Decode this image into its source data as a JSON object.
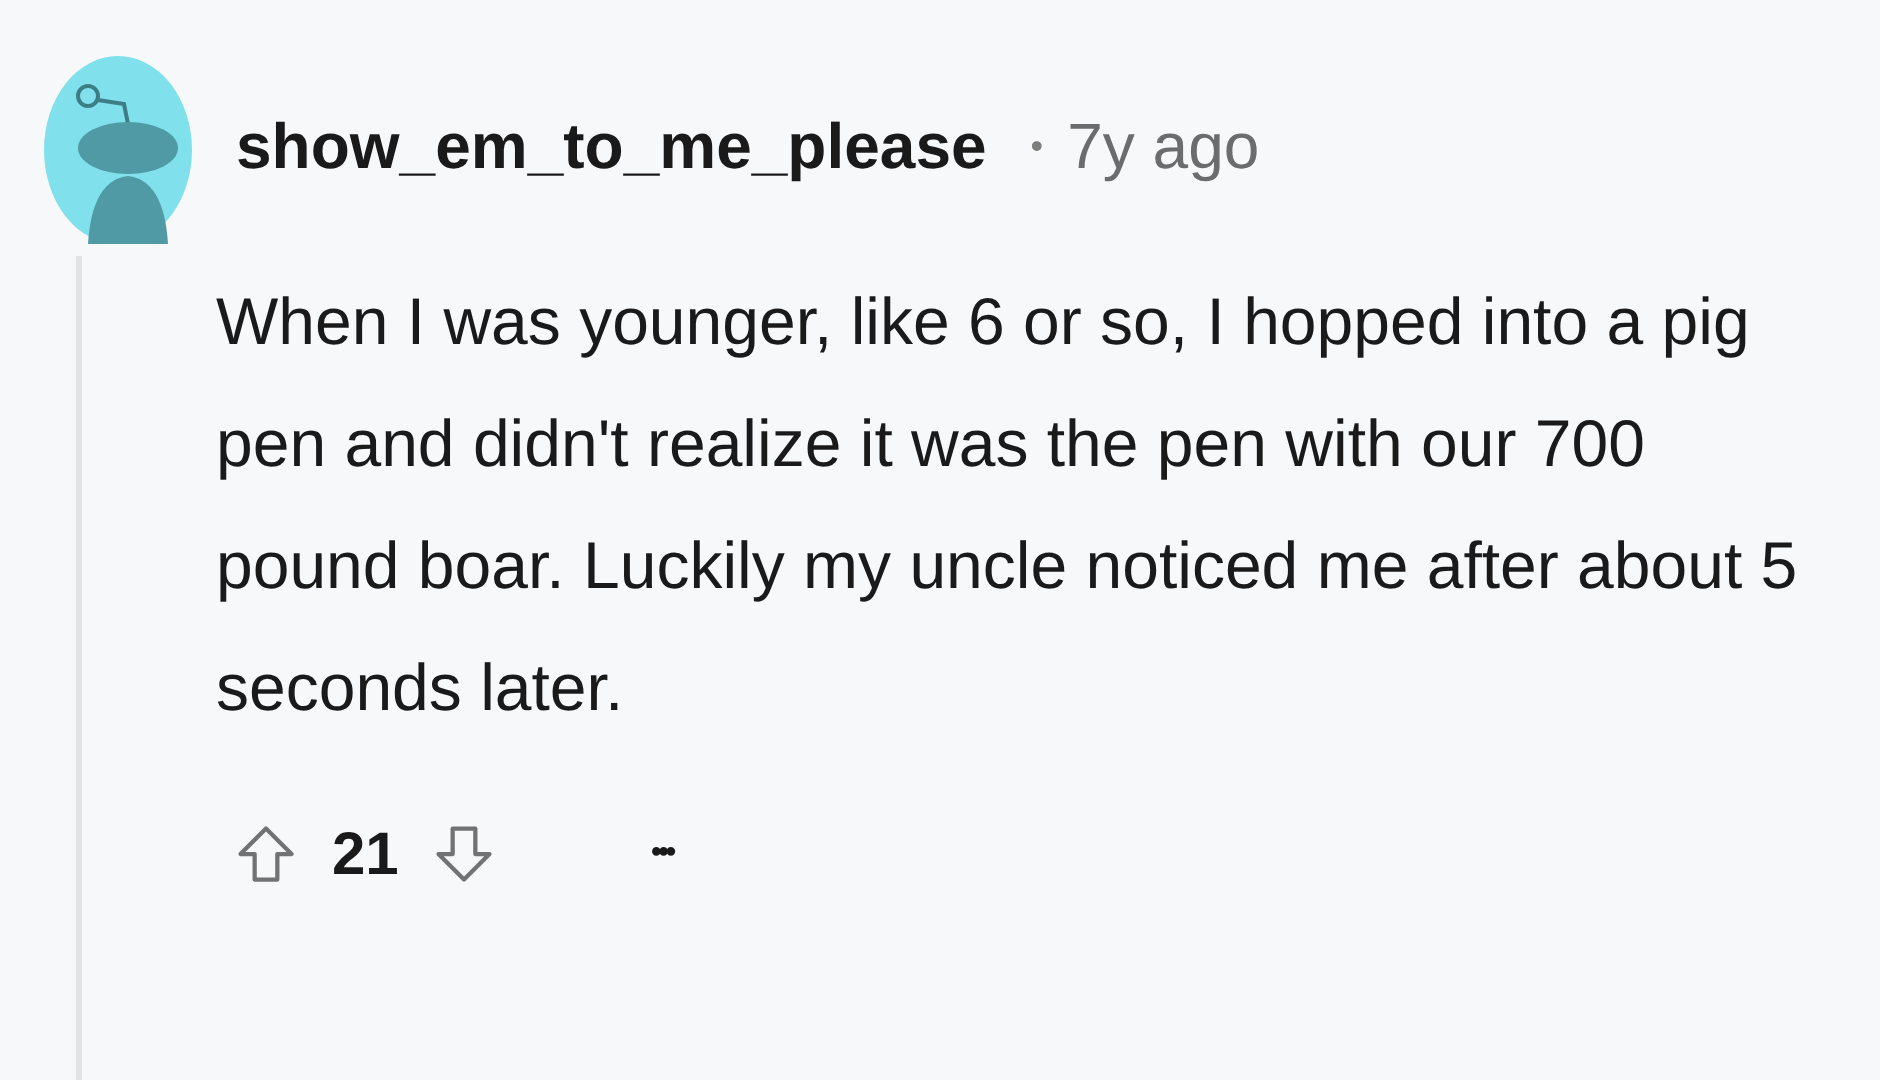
{
  "comment": {
    "author": "show_em_to_me_please",
    "separator": "•",
    "age": "7y ago",
    "body": "When I was younger, like 6 or so, I hopped into a pig pen and didn't realize it was the pen with our 700 pound boar. Luckily my uncle noticed me after about 5 seconds later.",
    "votes": "21",
    "more": "•••"
  }
}
